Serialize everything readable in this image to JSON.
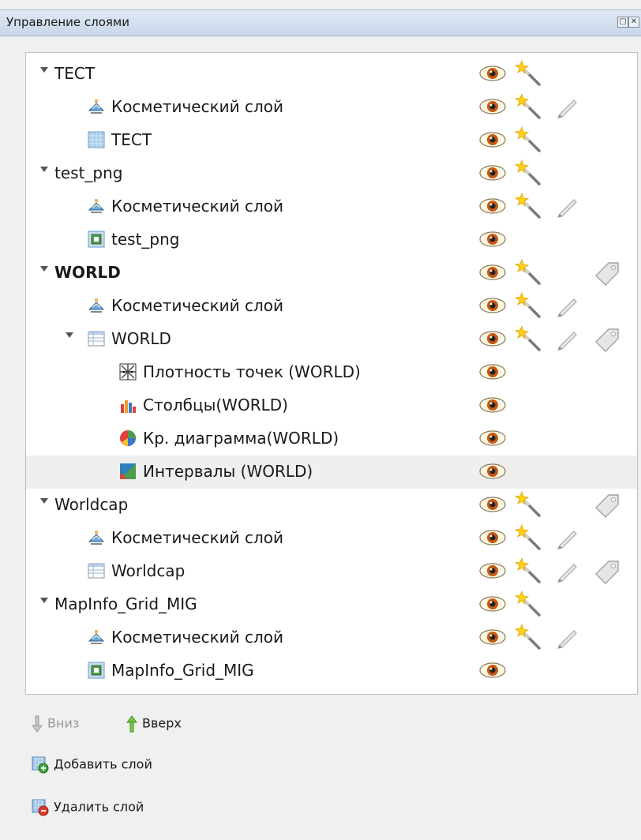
{
  "title": "Управление слоями",
  "layers": [
    {
      "label": "ТЕСТ",
      "level": 0,
      "expand": true,
      "icon": "none",
      "bold": false,
      "eye": true,
      "wand": true,
      "pencil": false,
      "tag": false
    },
    {
      "label": "Косметический слой",
      "level": 1,
      "expand": false,
      "icon": "cosmetic-layer",
      "bold": false,
      "eye": true,
      "wand": true,
      "pencil": true,
      "tag": false
    },
    {
      "label": "ТЕСТ",
      "level": 1,
      "expand": false,
      "icon": "raster-grid",
      "bold": false,
      "eye": true,
      "wand": true,
      "pencil": false,
      "tag": false
    },
    {
      "label": "test_png",
      "level": 0,
      "expand": true,
      "icon": "none",
      "bold": false,
      "eye": true,
      "wand": true,
      "pencil": false,
      "tag": false
    },
    {
      "label": "Косметический слой",
      "level": 1,
      "expand": false,
      "icon": "cosmetic-layer",
      "bold": false,
      "eye": true,
      "wand": true,
      "pencil": true,
      "tag": false
    },
    {
      "label": "test_png",
      "level": 1,
      "expand": false,
      "icon": "raster-image",
      "bold": false,
      "eye": true,
      "wand": false,
      "pencil": false,
      "tag": false
    },
    {
      "label": "WORLD",
      "level": 0,
      "expand": true,
      "icon": "none",
      "bold": true,
      "eye": true,
      "wand": true,
      "pencil": false,
      "tag": true
    },
    {
      "label": "Косметический слой",
      "level": 1,
      "expand": false,
      "icon": "cosmetic-layer",
      "bold": false,
      "eye": true,
      "wand": true,
      "pencil": true,
      "tag": false
    },
    {
      "label": "WORLD",
      "level": 1,
      "expand": true,
      "icon": "table",
      "bold": false,
      "eye": true,
      "wand": true,
      "pencil": true,
      "tag": true
    },
    {
      "label": "Плотность точек (WORLD)",
      "level": 2,
      "expand": false,
      "icon": "dot-density",
      "bold": false,
      "eye": true,
      "wand": false,
      "pencil": false,
      "tag": false
    },
    {
      "label": "Столбцы(WORLD)",
      "level": 2,
      "expand": false,
      "icon": "bar-chart",
      "bold": false,
      "eye": true,
      "wand": false,
      "pencil": false,
      "tag": false
    },
    {
      "label": "Кр. диаграмма(WORLD)",
      "level": 2,
      "expand": false,
      "icon": "pie-chart",
      "bold": false,
      "eye": true,
      "wand": false,
      "pencil": false,
      "tag": false
    },
    {
      "label": "Интервалы (WORLD)",
      "level": 2,
      "expand": false,
      "icon": "ranges",
      "bold": false,
      "eye": true,
      "wand": false,
      "pencil": false,
      "tag": false,
      "selected": true
    },
    {
      "label": "Worldcap",
      "level": 0,
      "expand": true,
      "icon": "none",
      "bold": false,
      "eye": true,
      "wand": true,
      "pencil": false,
      "tag": true
    },
    {
      "label": "Косметический слой",
      "level": 1,
      "expand": false,
      "icon": "cosmetic-layer",
      "bold": false,
      "eye": true,
      "wand": true,
      "pencil": true,
      "tag": false
    },
    {
      "label": "Worldcap",
      "level": 1,
      "expand": false,
      "icon": "table",
      "bold": false,
      "eye": true,
      "wand": true,
      "pencil": true,
      "tag": true
    },
    {
      "label": "MapInfo_Grid_MIG",
      "level": 0,
      "expand": true,
      "icon": "none",
      "bold": false,
      "eye": true,
      "wand": true,
      "pencil": false,
      "tag": false
    },
    {
      "label": "Косметический слой",
      "level": 1,
      "expand": false,
      "icon": "cosmetic-layer",
      "bold": false,
      "eye": true,
      "wand": true,
      "pencil": true,
      "tag": false
    },
    {
      "label": "MapInfo_Grid_MIG",
      "level": 1,
      "expand": false,
      "icon": "raster-image",
      "bold": false,
      "eye": true,
      "wand": false,
      "pencil": false,
      "tag": false
    }
  ],
  "buttons": {
    "down": "Вниз",
    "up": "Вверх",
    "add": "Добавить слой",
    "remove": "Удалить слой"
  }
}
